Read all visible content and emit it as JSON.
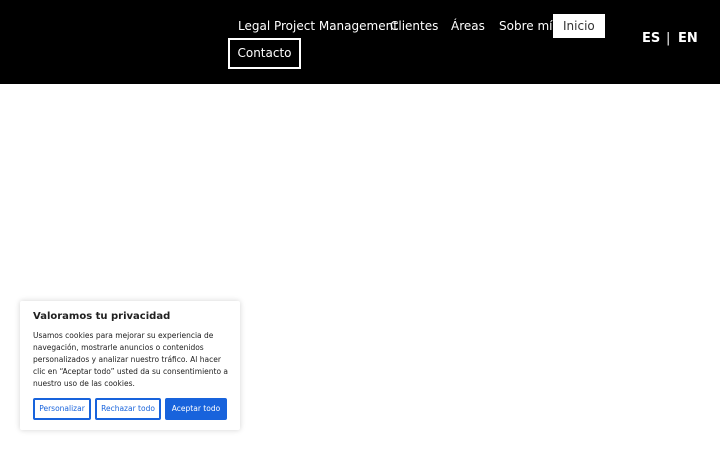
{
  "nav": {
    "items": [
      {
        "label": "Legal Project Management"
      },
      {
        "label": "Clientes"
      },
      {
        "label": "Áreas"
      },
      {
        "label": "Sobre mí"
      },
      {
        "label": "Inicio"
      },
      {
        "label": "Contacto"
      }
    ]
  },
  "lang": {
    "es": "ES",
    "separator": "|",
    "en": "EN"
  },
  "cookie": {
    "title": "Valoramos tu privacidad",
    "body": "Usamos cookies para mejorar su experiencia de navegación, mostrarle anuncios o contenidos personalizados y analizar nuestro tráfico. Al hacer clic en “Aceptar todo” usted da su consentimiento a nuestro uso de las cookies.",
    "buttons": {
      "customize": "Personalizar",
      "reject": "Rechazar todo",
      "accept": "Aceptar todo"
    }
  },
  "colors": {
    "header_bg": "#000000",
    "accent": "#1863dc"
  }
}
